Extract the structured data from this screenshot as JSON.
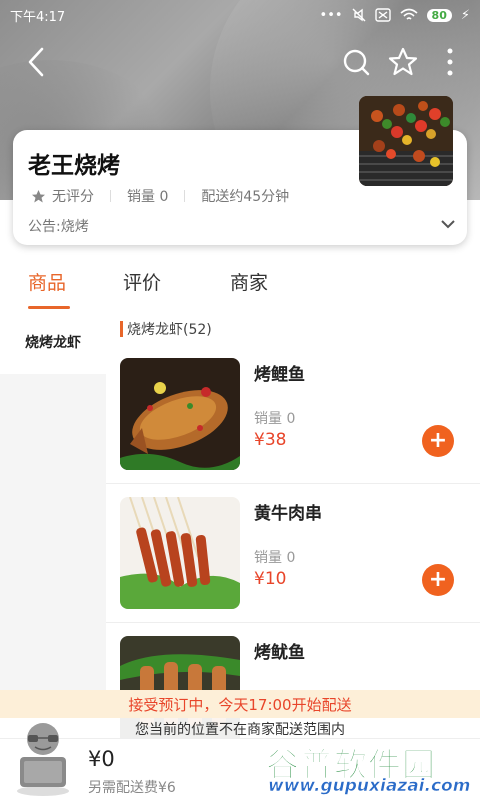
{
  "status_bar": {
    "time": "下午4:17",
    "battery": "80"
  },
  "store": {
    "name": "老王烧烤",
    "rating": "无评分",
    "sales": "销量 0",
    "delivery": "配送约45分钟",
    "notice": "公告:烧烤"
  },
  "tabs": [
    {
      "label": "商品"
    },
    {
      "label": "评价"
    },
    {
      "label": "商家"
    }
  ],
  "categories": [
    {
      "label": "烧烤龙虾"
    }
  ],
  "section": {
    "title": "烧烤龙虾(52)"
  },
  "products": [
    {
      "name": "烤鲤鱼",
      "sales": "销量 0",
      "price": "¥38"
    },
    {
      "name": "黄牛肉串",
      "sales": "销量 0",
      "price": "¥10"
    },
    {
      "name": "烤鱿鱼"
    }
  ],
  "banners": {
    "preorder": "接受预订中，今天17:00开始配送",
    "out_of_range": "您当前的位置不在商家配送范围内"
  },
  "cart": {
    "total": "¥0",
    "fee": "另需配送费¥6"
  },
  "watermark": {
    "title": "谷普软件园",
    "url": "www.gupuxiazai.com"
  },
  "colors": {
    "accent": "#e8662a",
    "price": "#e8452a",
    "add_button": "#f0621f"
  }
}
